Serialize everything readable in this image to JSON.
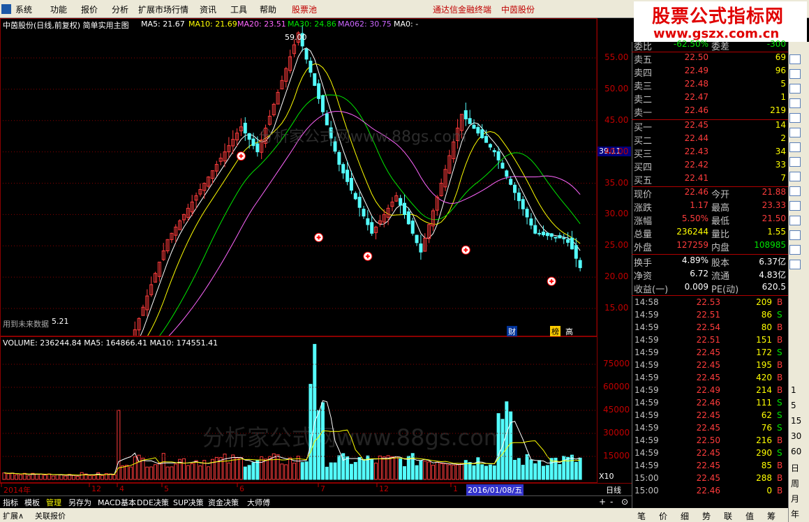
{
  "menu": {
    "items": [
      "系统",
      "功能",
      "报价",
      "分析",
      "扩展市场行情",
      "资讯",
      "工具",
      "帮助"
    ],
    "highlight": "股票池",
    "right": [
      "通达信金融终端",
      "中茵股份"
    ]
  },
  "watermark": {
    "title": "股票公式指标网",
    "url": "www.gszx.com.cn",
    "overlay1": "分析家公式网www.88gs.com",
    "overlay2": "分析家公式网www.88gs.com"
  },
  "chart": {
    "title": "中茵股份(日线,前复权) 简单实用主图",
    "ma5": "MA5: 21.67",
    "ma10": "MA10: 21.69",
    "ma20": "MA20: 23.51",
    "ma30": "MA30: 24.86",
    "ma062": "MA062: 30.75",
    "ma0": "MA0: -",
    "high_label": "59.00",
    "low_label": "5.21",
    "left_note": "用到未来数据",
    "cursor_price": "39.11",
    "price_axis": [
      "55.00",
      "50.00",
      "45.00",
      "40.00",
      "35.00",
      "30.00",
      "25.00",
      "20.00",
      "15.00"
    ],
    "markers": [
      "财",
      "榜",
      "高"
    ]
  },
  "volume": {
    "title": "VOLUME: 236244.84  MA5: 164866.41  MA10: 174551.41",
    "axis": [
      "75000",
      "60000",
      "45000",
      "30000",
      "15000"
    ],
    "unit": "X10"
  },
  "time_axis": {
    "labels": [
      "2014年",
      "12",
      "4",
      "5",
      "6",
      "7",
      "12",
      "1"
    ],
    "current_date": "2016/01/08/五",
    "period": "日线"
  },
  "tabs": [
    "指标",
    "模板",
    "管理",
    "另存为",
    "MACD基本",
    "DDE决策",
    "SUP决策",
    "资金决策",
    "大师傅"
  ],
  "tabs2": [
    "扩展∧",
    "关联报价"
  ],
  "quote": {
    "weibi": {
      "label": "委比",
      "value": "-62.50%",
      "label2": "委差",
      "value2": "-300"
    },
    "sells": [
      {
        "label": "卖五",
        "price": "22.50",
        "vol": "69"
      },
      {
        "label": "卖四",
        "price": "22.49",
        "vol": "96"
      },
      {
        "label": "卖三",
        "price": "22.48",
        "vol": "5"
      },
      {
        "label": "卖二",
        "price": "22.47",
        "vol": "1"
      },
      {
        "label": "卖一",
        "price": "22.46",
        "vol": "219"
      }
    ],
    "buys": [
      {
        "label": "买一",
        "price": "22.45",
        "vol": "14"
      },
      {
        "label": "买二",
        "price": "22.44",
        "vol": "2"
      },
      {
        "label": "买三",
        "price": "22.43",
        "vol": "34"
      },
      {
        "label": "买四",
        "price": "22.42",
        "vol": "33"
      },
      {
        "label": "买五",
        "price": "22.41",
        "vol": "7"
      }
    ],
    "stats": [
      {
        "l1": "现价",
        "v1": "22.46",
        "l2": "今开",
        "v2": "21.88"
      },
      {
        "l1": "涨跌",
        "v1": "1.17",
        "l2": "最高",
        "v2": "23.33"
      },
      {
        "l1": "涨幅",
        "v1": "5.50%",
        "l2": "最低",
        "v2": "21.50"
      },
      {
        "l1": "总量",
        "v1": "236244",
        "l2": "量比",
        "v2": "1.55"
      },
      {
        "l1": "外盘",
        "v1": "127259",
        "l2": "内盘",
        "v2": "108985"
      }
    ],
    "stats2": [
      {
        "l1": "换手",
        "v1": "4.89%",
        "l2": "股本",
        "v2": "6.37亿"
      },
      {
        "l1": "净资",
        "v1": "6.72",
        "l2": "流通",
        "v2": "4.83亿"
      },
      {
        "l1": "收益(一)",
        "v1": "0.009",
        "l2": "PE(动)",
        "v2": "620.5"
      }
    ]
  },
  "ticks": [
    {
      "t": "14:58",
      "p": "22.53",
      "v": "209",
      "bs": "B"
    },
    {
      "t": "14:59",
      "p": "22.51",
      "v": "86",
      "bs": "S"
    },
    {
      "t": "14:59",
      "p": "22.54",
      "v": "80",
      "bs": "B"
    },
    {
      "t": "14:59",
      "p": "22.51",
      "v": "151",
      "bs": "B"
    },
    {
      "t": "14:59",
      "p": "22.45",
      "v": "172",
      "bs": "S"
    },
    {
      "t": "14:59",
      "p": "22.45",
      "v": "195",
      "bs": "B"
    },
    {
      "t": "14:59",
      "p": "22.45",
      "v": "420",
      "bs": "B"
    },
    {
      "t": "14:59",
      "p": "22.49",
      "v": "214",
      "bs": "B"
    },
    {
      "t": "14:59",
      "p": "22.46",
      "v": "111",
      "bs": "S"
    },
    {
      "t": "14:59",
      "p": "22.45",
      "v": "62",
      "bs": "S"
    },
    {
      "t": "14:59",
      "p": "22.45",
      "v": "76",
      "bs": "S"
    },
    {
      "t": "14:59",
      "p": "22.50",
      "v": "216",
      "bs": "B"
    },
    {
      "t": "14:59",
      "p": "22.45",
      "v": "290",
      "bs": "S"
    },
    {
      "t": "14:59",
      "p": "22.45",
      "v": "85",
      "bs": "B"
    },
    {
      "t": "15:00",
      "p": "22.45",
      "v": "288",
      "bs": "B"
    },
    {
      "t": "15:00",
      "p": "22.46",
      "v": "0",
      "bs": "B"
    }
  ],
  "side_tools": [
    "1",
    "5",
    "15",
    "30",
    "60",
    "日",
    "周",
    "月",
    "年"
  ],
  "bottom_tabs": [
    "笔",
    "价",
    "细",
    "势",
    "联",
    "值",
    "筹"
  ],
  "colors": {
    "up": "#ff3c3c",
    "down": "#54fcfc",
    "ma5": "#ffffff",
    "ma10": "#ffff00",
    "ma20": "#ff66ff",
    "ma30": "#00e600",
    "ma062": "#cc66ff",
    "grid": "#8b0000"
  }
}
